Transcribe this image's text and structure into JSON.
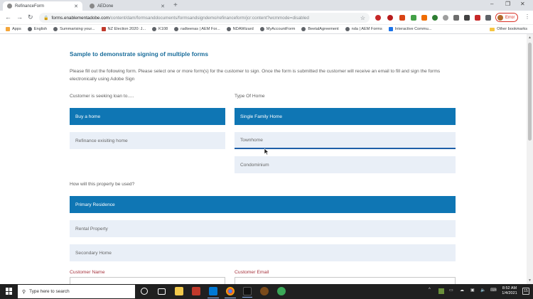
{
  "browser": {
    "tabs": [
      {
        "title": "RefinanceForm",
        "active": true
      },
      {
        "title": "AEDone",
        "active": false
      }
    ],
    "url_host": "forms.enablementadobe.com",
    "url_path": "/content/dam/formsanddocuments/formsandsigndemo/refinanceform/jcr:content?wcmmode=disabled",
    "profile_button": "Error",
    "bookmarks": [
      "Apps",
      "English",
      "Summarising your...",
      "NZ Election 2020: J...",
      "K108",
      "radteenas | AEM For...",
      "NDAWizard",
      "MyAccountForm",
      "BeetalAgreement",
      "nda | AEM Forms",
      "Interactive Commu..."
    ],
    "other_bookmarks": "Other bookmarks"
  },
  "page": {
    "title": "Sample to demonstrate signing of multiple forms",
    "intro": "Please fill out the following form. Please select one or more form(s) for the customer to sign. Once the form is submitted the customer will receive an email to fill and sign the forms electronically using Adobe Sign",
    "loan_question": "Customer is seeking loan to.....",
    "loan_options": [
      {
        "label": "Buy a home",
        "selected": true
      },
      {
        "label": "Refinance exisiting home",
        "selected": false
      }
    ],
    "home_question": "Type Of Home",
    "home_options": [
      {
        "label": "Single Family Home",
        "selected": true
      },
      {
        "label": "Townhome",
        "selected": false
      },
      {
        "label": "Condominium",
        "selected": false
      }
    ],
    "use_question": "How will this property be used?",
    "use_options": [
      {
        "label": "Primary Residence",
        "selected": true
      },
      {
        "label": "Rental Property",
        "selected": false
      },
      {
        "label": "Secondary Home",
        "selected": false
      }
    ],
    "customer_name_label": "Customer Name",
    "customer_email_label": "Customer Email"
  },
  "taskbar": {
    "search_placeholder": "Type here to search",
    "time": "8:52 AM",
    "date": "1/4/2021",
    "notification_count": "15"
  },
  "colors": {
    "accent": "#0f76b4",
    "option_bg": "#e9eff7",
    "title": "#1a6d9b",
    "field_label": "#a5323c"
  }
}
